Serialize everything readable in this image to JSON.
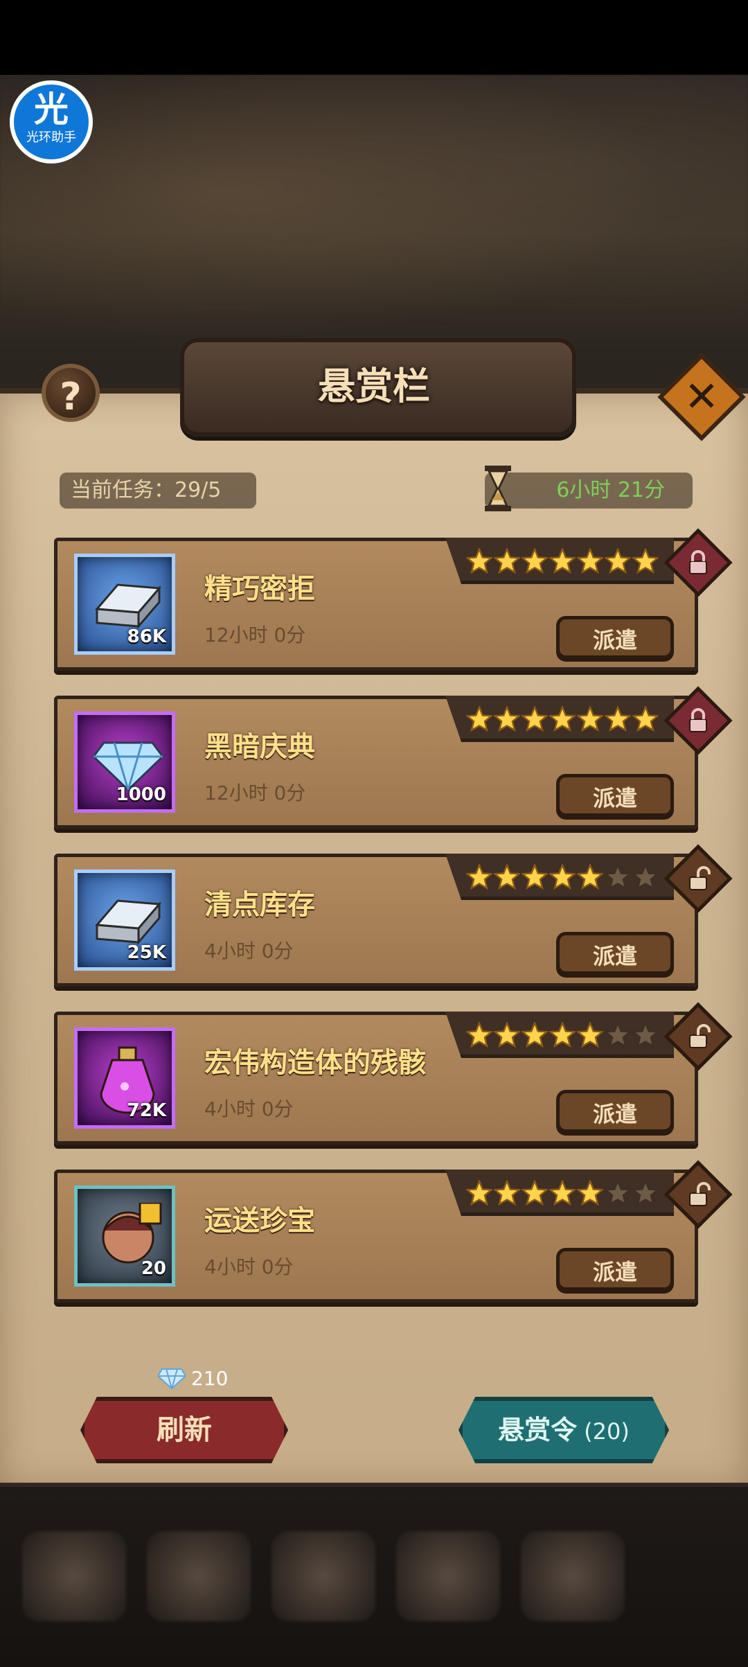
{
  "overlay": {
    "assistant_label": "光环助手",
    "assistant_char": "光"
  },
  "header": {
    "title": "悬赏栏",
    "help_symbol": "?",
    "close_symbol": "✕"
  },
  "status": {
    "task_label": "当前任务：",
    "task_value": "29/5",
    "timer": "6小时 21分"
  },
  "missions": [
    {
      "title": "精巧密拒",
      "duration": "12小时 0分",
      "qty": "86K",
      "stars": 7,
      "locked": true,
      "icon": "silver-ingot-icon"
    },
    {
      "title": "黑暗庆典",
      "duration": "12小时 0分",
      "qty": "1000",
      "stars": 7,
      "locked": true,
      "icon": "diamond-icon"
    },
    {
      "title": "清点库存",
      "duration": "4小时 0分",
      "qty": "25K",
      "stars": 5,
      "locked": false,
      "icon": "silver-ingot-icon"
    },
    {
      "title": "宏伟构造体的残骸",
      "duration": "4小时 0分",
      "qty": "72K",
      "stars": 5,
      "locked": false,
      "icon": "potion-icon"
    },
    {
      "title": "运送珍宝",
      "duration": "4小时 0分",
      "qty": "20",
      "stars": 5,
      "locked": false,
      "icon": "hero-portrait-icon"
    }
  ],
  "dispatch_label": "派遣",
  "footer": {
    "refresh_cost": "210",
    "refresh_label": "刷新",
    "order_label": "悬赏令",
    "order_count": "(20)"
  },
  "colors": {
    "accent_gold": "#ffe08a",
    "timer_green": "#7ed05a",
    "refresh_red": "#8a2a2a",
    "order_teal": "#1f6f72"
  }
}
